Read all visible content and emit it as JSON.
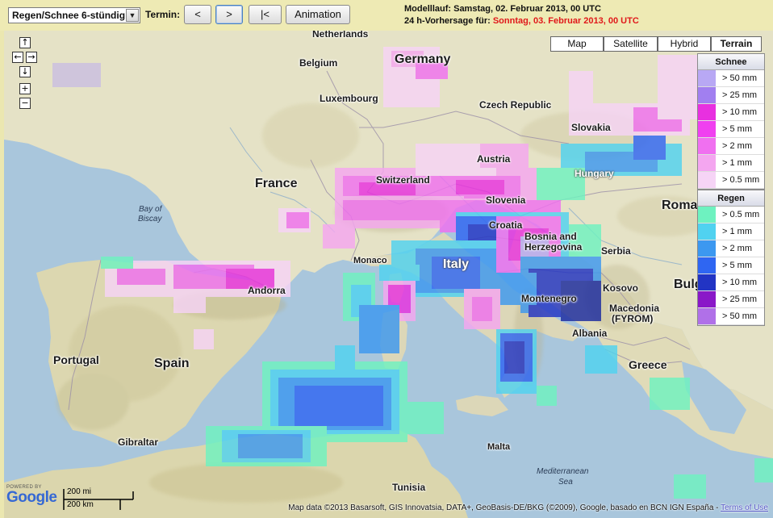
{
  "toolbar": {
    "product_select": "Regen/Schnee 6-stündig",
    "termin_label": "Termin:",
    "btn_prev": "<",
    "btn_next": ">",
    "btn_first": "|<",
    "btn_animation": "Animation",
    "modelllauf_label": "Modelllauf: Samstag, 02. Februar 2013, 00 UTC",
    "forecast_label": "24 h-Vorhersage für:",
    "forecast_date": "Sonntag, 03. Februar 2013, 00 UTC"
  },
  "map_types": {
    "map": "Map",
    "satellite": "Satellite",
    "hybrid": "Hybrid",
    "terrain": "Terrain",
    "selected": "Terrain"
  },
  "navigation": {
    "pan_up": "↑",
    "pan_left": "←",
    "pan_right": "→",
    "pan_down": "↓",
    "zoom_in": "+",
    "zoom_out": "−"
  },
  "legend": {
    "snow": {
      "title": "Schnee",
      "items": [
        {
          "label": "> 50 mm",
          "color": "#b8a8f4"
        },
        {
          "label": "> 25 mm",
          "color": "#a17ff0"
        },
        {
          "label": "> 10 mm",
          "color": "#e830e0"
        },
        {
          "label": "> 5 mm",
          "color": "#f040f0"
        },
        {
          "label": "> 2 mm",
          "color": "#f070f0"
        },
        {
          "label": "> 1 mm",
          "color": "#f4a6f0"
        },
        {
          "label": "> 0.5 mm",
          "color": "#f6d4f6"
        }
      ]
    },
    "rain": {
      "title": "Regen",
      "items": [
        {
          "label": "> 0.5 mm",
          "color": "#6ef2c0"
        },
        {
          "label": "> 1 mm",
          "color": "#50d2f0"
        },
        {
          "label": "> 2 mm",
          "color": "#3c98f0"
        },
        {
          "label": "> 5 mm",
          "color": "#2f66f2"
        },
        {
          "label": "> 10 mm",
          "color": "#2234c4"
        },
        {
          "label": "> 25 mm",
          "color": "#8a18c8"
        },
        {
          "label": "> 50 mm",
          "color": "#b070e8"
        }
      ]
    }
  },
  "labels": {
    "netherlands": "Netherlands",
    "belgium": "Belgium",
    "germany": "Germany",
    "luxembourg": "Luxembourg",
    "czech": "Czech Republic",
    "slovakia": "Slovakia",
    "austria": "Austria",
    "hungary": "Hungary",
    "switzerland": "Switzerland",
    "slovenia": "Slovenia",
    "croatia": "Croatia",
    "france": "France",
    "bay_biscay_1": "Bay of",
    "bay_biscay_2": "Biscay",
    "romania": "Roma",
    "serbia": "Serbia",
    "bosnia_1": "Bosnia and",
    "bosnia_2": "Herzegovina",
    "monaco": "Monaco",
    "italy": "Italy",
    "kosovo": "Kosovo",
    "bulgaria": "Bulg",
    "andorra": "Andorra",
    "montenegro": "Montenegro",
    "macedonia_1": "Macedonia",
    "macedonia_2": "(FYROM)",
    "albania": "Albania",
    "portugal": "Portugal",
    "spain": "Spain",
    "greece": "Greece",
    "gibraltar": "Gibraltar",
    "malta": "Malta",
    "med_sea_1": "Mediterranean",
    "med_sea_2": "Sea",
    "tunisia": "Tunisia"
  },
  "footer": {
    "powered_by": "POWERED BY",
    "google": "Google",
    "scale_mi": "200 mi",
    "scale_km": "200 km",
    "copyright": "Map data ©2013 Basarsoft, GIS Innovatsia, DATA+, GeoBasis-DE/BKG (©2009), Google, basado en BCN IGN España - ",
    "terms": "Terms of Use"
  }
}
